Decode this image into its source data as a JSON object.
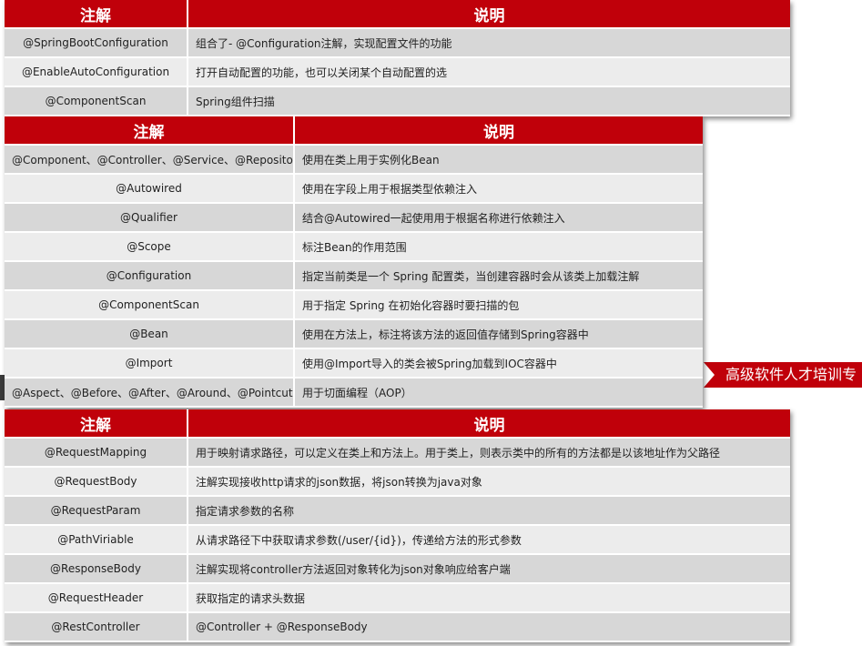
{
  "banner": {
    "text": "高级软件人才培训专"
  },
  "table1": {
    "headers": [
      "注解",
      "说明"
    ],
    "rows": [
      [
        "@SpringBootConfiguration",
        "组合了- @Configuration注解，实现配置文件的功能"
      ],
      [
        "@EnableAutoConfiguration",
        "打开自动配置的功能，也可以关闭某个自动配置的选"
      ],
      [
        "@ComponentScan",
        "Spring组件扫描"
      ]
    ]
  },
  "table2": {
    "headers": [
      "注解",
      "说明"
    ],
    "rows": [
      [
        "@Component、@Controller、@Service、@Repository",
        "使用在类上用于实例化Bean"
      ],
      [
        "@Autowired",
        "使用在字段上用于根据类型依赖注入"
      ],
      [
        "@Qualifier",
        "结合@Autowired一起使用用于根据名称进行依赖注入"
      ],
      [
        "@Scope",
        "标注Bean的作用范围"
      ],
      [
        "@Configuration",
        "指定当前类是一个 Spring 配置类，当创建容器时会从该类上加载注解"
      ],
      [
        "@ComponentScan",
        "用于指定 Spring  在初始化容器时要扫描的包"
      ],
      [
        "@Bean",
        "使用在方法上，标注将该方法的返回值存储到Spring容器中"
      ],
      [
        "@Import",
        "使用@Import导入的类会被Spring加载到IOC容器中"
      ],
      [
        "@Aspect、@Before、@After、@Around、@Pointcut",
        "用于切面编程（AOP）"
      ]
    ]
  },
  "table3": {
    "headers": [
      "注解",
      "说明"
    ],
    "rows": [
      [
        "@RequestMapping",
        "用于映射请求路径，可以定义在类上和方法上。用于类上，则表示类中的所有的方法都是以该地址作为父路径"
      ],
      [
        "@RequestBody",
        "注解实现接收http请求的json数据，将json转换为java对象"
      ],
      [
        "@RequestParam",
        "指定请求参数的名称"
      ],
      [
        "@PathViriable",
        "从请求路径下中获取请求参数(/user/{id})，传递给方法的形式参数"
      ],
      [
        "@ResponseBody",
        "注解实现将controller方法返回对象转化为json对象响应给客户端"
      ],
      [
        "@RequestHeader",
        "获取指定的请求头数据"
      ],
      [
        "@RestController",
        "@Controller + @ResponseBody"
      ]
    ]
  }
}
